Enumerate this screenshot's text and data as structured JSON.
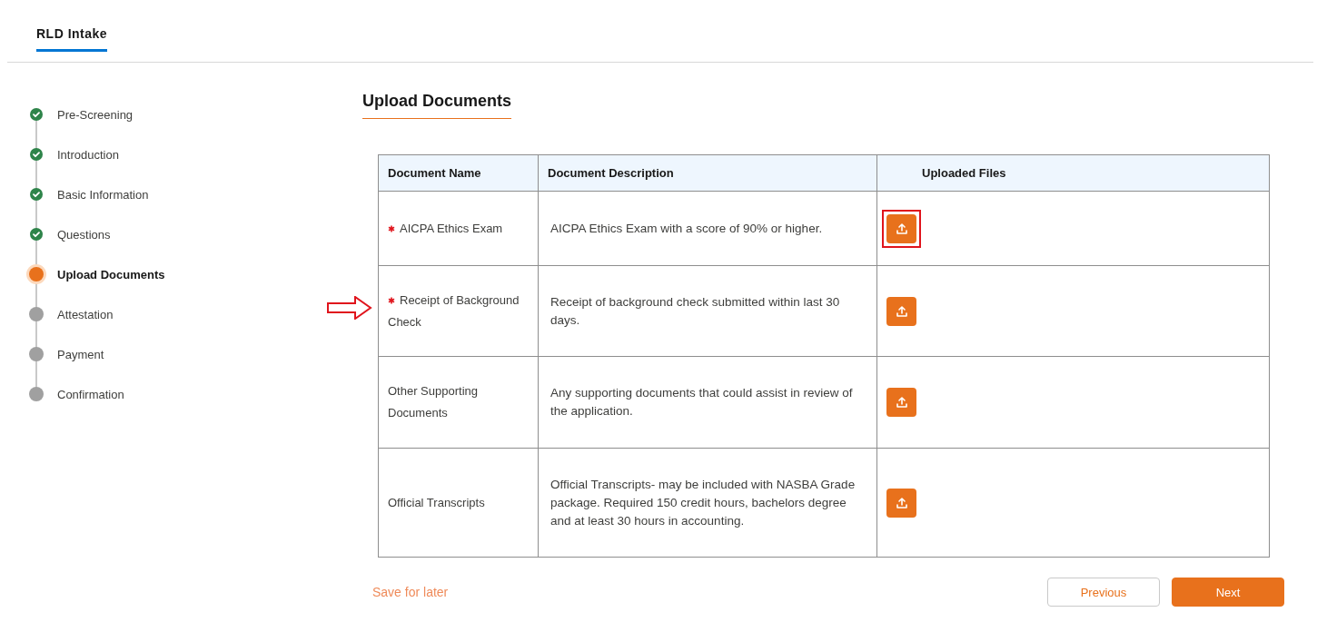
{
  "header": {
    "tab": {
      "label": "RLD Intake",
      "selected": true
    }
  },
  "steps": [
    {
      "label": "Pre-Screening",
      "completed": true,
      "selected": false
    },
    {
      "label": "Introduction",
      "completed": true,
      "selected": false
    },
    {
      "label": "Basic Information",
      "completed": true,
      "selected": false
    },
    {
      "label": "Questions",
      "completed": true,
      "selected": false
    },
    {
      "label": "Upload Documents",
      "completed": false,
      "selected": true
    },
    {
      "label": "Attestation",
      "completed": false,
      "selected": false
    },
    {
      "label": "Payment",
      "completed": false,
      "selected": false
    },
    {
      "label": "Confirmation",
      "completed": false,
      "selected": false
    }
  ],
  "title": "Upload Documents",
  "table": {
    "columns": [
      "Document Name",
      "Document Description",
      "Uploaded Files"
    ],
    "rows": [
      {
        "name": "AICPA Ethics Exam",
        "required": true,
        "description": "AICPA Ethics Exam with a score of 90% or higher.",
        "upload_highlighted": true,
        "arrow": false
      },
      {
        "name": "Receipt of Background Check",
        "required": true,
        "description": "Receipt of background check submitted within last 30 days.",
        "upload_highlighted": false,
        "arrow": true
      },
      {
        "name": "Other Supporting Documents",
        "required": false,
        "description": "Any supporting documents that could assist in review of the application.",
        "upload_highlighted": false,
        "arrow": false
      },
      {
        "name": "Official Transcripts",
        "required": false,
        "description": "Official Transcripts- may be included with NASBA Grade package. Required 150 credit hours, bachelors degree and at least 30 hours in accounting.",
        "upload_highlighted": false,
        "arrow": false
      }
    ]
  },
  "footer": {
    "save_link": "Save for later",
    "previous": "Previous",
    "next": "Next"
  }
}
